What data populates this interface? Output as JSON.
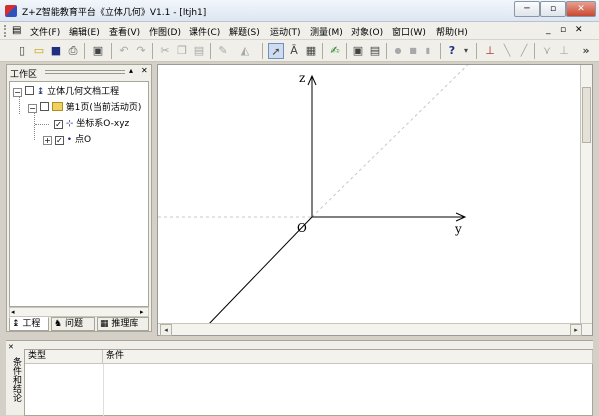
{
  "window": {
    "title": "Z+Z智能教育平台《立体几何》V1.1 - [ltjh1]",
    "minimize_glyph": "─",
    "maximize_glyph": "▫",
    "close_glyph": "✕",
    "mdi_minimize_glyph": "_",
    "mdi_restore_glyph": "▫",
    "mdi_close_glyph": "✕"
  },
  "menu": [
    {
      "label": "文件(F)"
    },
    {
      "label": "编辑(E)"
    },
    {
      "label": "查看(V)"
    },
    {
      "label": "作图(D)"
    },
    {
      "label": "课件(C)"
    },
    {
      "label": "解题(S)"
    },
    {
      "label": "运动(T)"
    },
    {
      "label": "测量(M)"
    },
    {
      "label": "对象(O)"
    },
    {
      "label": "窗口(W)"
    },
    {
      "label": "帮助(H)"
    }
  ],
  "toolbar": {
    "icons": [
      {
        "name": "new-file-icon",
        "glyph": "▯"
      },
      {
        "name": "open-folder-icon",
        "glyph": "▭"
      },
      {
        "name": "save-icon",
        "glyph": "■"
      },
      {
        "name": "print-icon",
        "glyph": "⎙"
      },
      {
        "name": "preview-icon",
        "glyph": "▣"
      },
      {
        "name": "undo-icon",
        "glyph": "↶"
      },
      {
        "name": "redo-icon",
        "glyph": "↷"
      },
      {
        "name": "cut-icon",
        "glyph": "✂"
      },
      {
        "name": "copy-icon",
        "glyph": "❐"
      },
      {
        "name": "paste-icon",
        "glyph": "▤"
      },
      {
        "name": "pen-icon",
        "glyph": "✎"
      },
      {
        "name": "fill-icon",
        "glyph": "◭"
      },
      {
        "name": "select-arrow-icon",
        "glyph": "➚"
      },
      {
        "name": "text-tool-icon",
        "glyph": "Ā"
      },
      {
        "name": "label-tool-icon",
        "glyph": "▦"
      },
      {
        "name": "draw-tool-icon",
        "glyph": "✍"
      },
      {
        "name": "record-icon",
        "glyph": "▣"
      },
      {
        "name": "display-icon",
        "glyph": "▤"
      },
      {
        "name": "play-icon",
        "glyph": "●"
      },
      {
        "name": "stop-icon",
        "glyph": "■"
      },
      {
        "name": "step-icon",
        "glyph": "▮"
      },
      {
        "name": "help-pointer-icon",
        "glyph": "?"
      },
      {
        "name": "dropdown-icon",
        "glyph": "▾"
      },
      {
        "name": "ruler-icon",
        "glyph": "⊥"
      },
      {
        "name": "segment-icon",
        "glyph": "╲"
      },
      {
        "name": "line-icon",
        "glyph": "╱"
      },
      {
        "name": "angle-icon",
        "glyph": "⋎"
      },
      {
        "name": "perpendicular-icon",
        "glyph": "⊥"
      },
      {
        "name": "toolbar-overflow-icon",
        "glyph": "»"
      }
    ]
  },
  "left_panel": {
    "title": "工作区",
    "pin_glyph": "▴",
    "close_glyph": "✕",
    "tree": [
      {
        "expander": "−",
        "icon_glyph": "↨",
        "label": "立体几何文档工程",
        "checked": false
      },
      {
        "expander": "−",
        "icon_glyph": "▬",
        "label": "第1页(当前活动页)",
        "checked": false
      },
      {
        "expander": "",
        "icon_glyph": "⊹",
        "label": "坐标系O-xyz",
        "checked": true
      },
      {
        "expander": "+",
        "icon_glyph": "•",
        "label": "点O",
        "checked": true
      }
    ],
    "tabs": [
      {
        "icon_glyph": "↨",
        "label": "工程"
      },
      {
        "icon_glyph": "♞",
        "label": "问题"
      },
      {
        "icon_glyph": "▦",
        "label": "推理库"
      }
    ]
  },
  "canvas": {
    "axis_z": "z",
    "axis_y": "y",
    "origin": "O"
  },
  "bottom_panel": {
    "side_label": "条件和结论",
    "columns": [
      "类型",
      "条件"
    ]
  }
}
